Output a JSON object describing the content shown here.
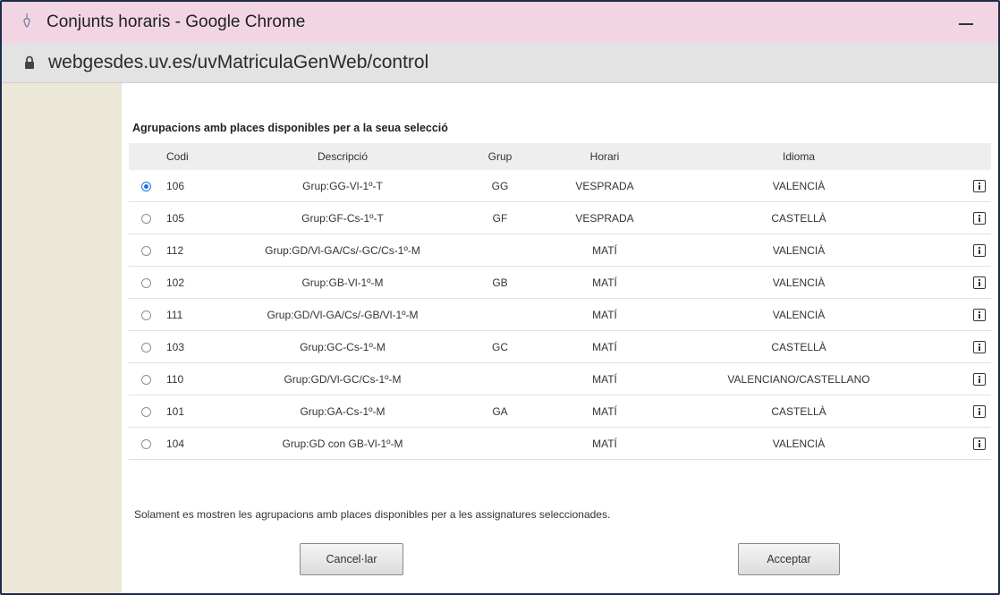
{
  "window": {
    "title": "Conjunts horaris - Google Chrome",
    "url": "webgesdes.uv.es/uvMatriculaGenWeb/control"
  },
  "dialog": {
    "heading": "Agrupacions amb places disponibles per a la seua selecció",
    "columns": {
      "codi": "Codi",
      "descripcio": "Descripció",
      "grup": "Grup",
      "horari": "Horari",
      "idioma": "Idioma"
    },
    "rows": [
      {
        "selected": true,
        "codi": "106",
        "descripcio": "Grup:GG-Vl-1º-T",
        "grup": "GG",
        "horari": "VESPRADA",
        "idioma": "VALENCIÀ"
      },
      {
        "selected": false,
        "codi": "105",
        "descripcio": "Grup:GF-Cs-1º-T",
        "grup": "GF",
        "horari": "VESPRADA",
        "idioma": "CASTELLÀ"
      },
      {
        "selected": false,
        "codi": "112",
        "descripcio": "Grup:GD/Vl-GA/Cs/-GC/Cs-1º-M",
        "grup": "",
        "horari": "MATÍ",
        "idioma": "VALENCIÀ"
      },
      {
        "selected": false,
        "codi": "102",
        "descripcio": "Grup:GB-Vl-1º-M",
        "grup": "GB",
        "horari": "MATÍ",
        "idioma": "VALENCIÀ"
      },
      {
        "selected": false,
        "codi": "111",
        "descripcio": "Grup:GD/Vl-GA/Cs/-GB/Vl-1º-M",
        "grup": "",
        "horari": "MATÍ",
        "idioma": "VALENCIÀ"
      },
      {
        "selected": false,
        "codi": "103",
        "descripcio": "Grup:GC-Cs-1º-M",
        "grup": "GC",
        "horari": "MATÍ",
        "idioma": "CASTELLÀ"
      },
      {
        "selected": false,
        "codi": "110",
        "descripcio": "Grup:GD/Vl-GC/Cs-1º-M",
        "grup": "",
        "horari": "MATÍ",
        "idioma": "VALENCIANO/CASTELLANO"
      },
      {
        "selected": false,
        "codi": "101",
        "descripcio": "Grup:GA-Cs-1º-M",
        "grup": "GA",
        "horari": "MATÍ",
        "idioma": "CASTELLÀ"
      },
      {
        "selected": false,
        "codi": "104",
        "descripcio": "Grup:GD con GB-Vl-1º-M",
        "grup": "",
        "horari": "MATÍ",
        "idioma": "VALENCIÀ"
      }
    ],
    "note": "Solament es mostren les agrupacions amb places disponibles per a les assignatures seleccionades.",
    "cancel_label": "Cancel·lar",
    "accept_label": "Acceptar"
  },
  "colors": {
    "titlebar": "#f2d5e2",
    "addressbar": "#e3e3e3",
    "sidebar": "#ebe8d8",
    "header_row": "#eeeeee",
    "radio_selected": "#1a73e8"
  }
}
